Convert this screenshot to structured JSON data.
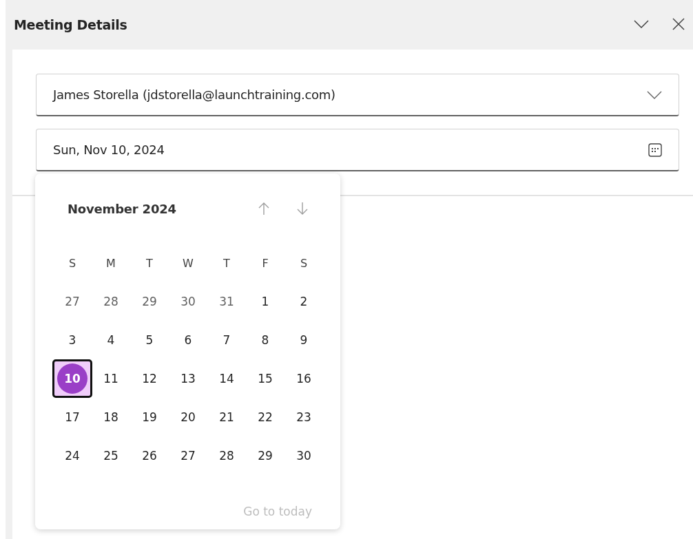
{
  "pane": {
    "title": "Meeting Details"
  },
  "organizer": {
    "value": "James Storella (jdstorella@launchtraining.com)"
  },
  "date_field": {
    "value": "Sun, Nov 10, 2024"
  },
  "calendar": {
    "month": "November 2024",
    "weekdays": [
      "S",
      "M",
      "T",
      "W",
      "T",
      "F",
      "S"
    ],
    "weeks": [
      [
        {
          "label": "27",
          "outside": true,
          "selected": false
        },
        {
          "label": "28",
          "outside": true,
          "selected": false
        },
        {
          "label": "29",
          "outside": true,
          "selected": false
        },
        {
          "label": "30",
          "outside": true,
          "selected": false
        },
        {
          "label": "31",
          "outside": true,
          "selected": false
        },
        {
          "label": "1",
          "outside": false,
          "selected": false
        },
        {
          "label": "2",
          "outside": false,
          "selected": false
        }
      ],
      [
        {
          "label": "3",
          "outside": false,
          "selected": false
        },
        {
          "label": "4",
          "outside": false,
          "selected": false
        },
        {
          "label": "5",
          "outside": false,
          "selected": false
        },
        {
          "label": "6",
          "outside": false,
          "selected": false
        },
        {
          "label": "7",
          "outside": false,
          "selected": false
        },
        {
          "label": "8",
          "outside": false,
          "selected": false
        },
        {
          "label": "9",
          "outside": false,
          "selected": false
        }
      ],
      [
        {
          "label": "10",
          "outside": false,
          "selected": true
        },
        {
          "label": "11",
          "outside": false,
          "selected": false
        },
        {
          "label": "12",
          "outside": false,
          "selected": false
        },
        {
          "label": "13",
          "outside": false,
          "selected": false
        },
        {
          "label": "14",
          "outside": false,
          "selected": false
        },
        {
          "label": "15",
          "outside": false,
          "selected": false
        },
        {
          "label": "16",
          "outside": false,
          "selected": false
        }
      ],
      [
        {
          "label": "17",
          "outside": false,
          "selected": false
        },
        {
          "label": "18",
          "outside": false,
          "selected": false
        },
        {
          "label": "19",
          "outside": false,
          "selected": false
        },
        {
          "label": "20",
          "outside": false,
          "selected": false
        },
        {
          "label": "21",
          "outside": false,
          "selected": false
        },
        {
          "label": "22",
          "outside": false,
          "selected": false
        },
        {
          "label": "23",
          "outside": false,
          "selected": false
        }
      ],
      [
        {
          "label": "24",
          "outside": false,
          "selected": false
        },
        {
          "label": "25",
          "outside": false,
          "selected": false
        },
        {
          "label": "26",
          "outside": false,
          "selected": false
        },
        {
          "label": "27",
          "outside": false,
          "selected": false
        },
        {
          "label": "28",
          "outside": false,
          "selected": false
        },
        {
          "label": "29",
          "outside": false,
          "selected": false
        },
        {
          "label": "30",
          "outside": false,
          "selected": false
        }
      ]
    ],
    "go_to_today": {
      "label": "Go to today",
      "disabled": true
    }
  }
}
